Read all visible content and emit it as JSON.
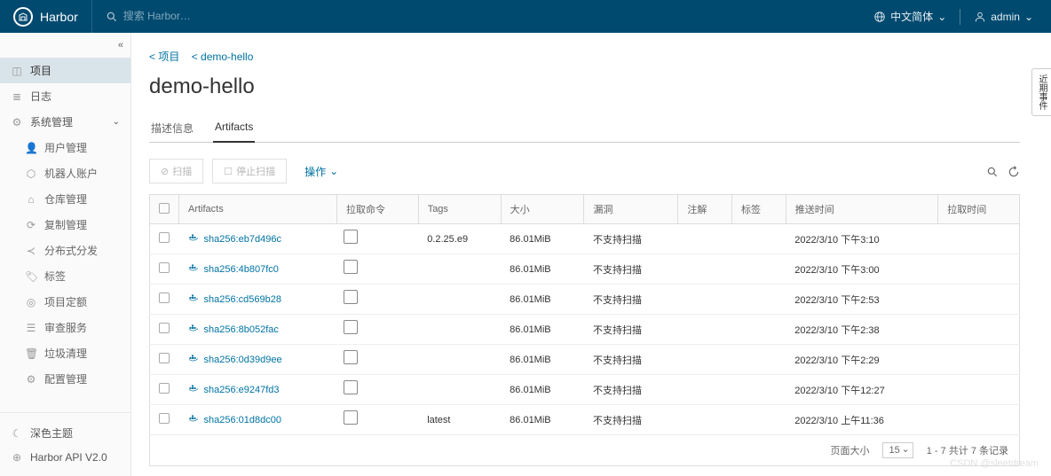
{
  "header": {
    "brand": "Harbor",
    "search_placeholder": "搜索 Harbor…",
    "language": "中文简体",
    "user": "admin"
  },
  "sidebar": {
    "projects": "项目",
    "logs": "日志",
    "admin": "系统管理",
    "sub": {
      "users": "用户管理",
      "robots": "机器人账户",
      "repos": "仓库管理",
      "replication": "复制管理",
      "distribution": "分布式分发",
      "labels": "标签",
      "quotas": "项目定额",
      "audit": "审查服务",
      "gc": "垃圾清理",
      "config": "配置管理"
    },
    "bottom": {
      "theme": "深色主题",
      "api": "Harbor API V2.0"
    }
  },
  "breadcrumb": {
    "back1": "< 项目",
    "back2": "< demo-hello"
  },
  "page_title": "demo-hello",
  "tabs": {
    "info": "描述信息",
    "artifacts": "Artifacts"
  },
  "toolbar": {
    "scan": "扫描",
    "stop_scan": "停止扫描",
    "actions": "操作"
  },
  "columns": {
    "artifacts": "Artifacts",
    "pull_cmd": "拉取命令",
    "tags": "Tags",
    "size": "大小",
    "vuln": "漏洞",
    "annotations": "注解",
    "labels": "标签",
    "push_time": "推送时间",
    "pull_time": "拉取时间"
  },
  "rows": [
    {
      "digest": "sha256:eb7d496c",
      "tags": "0.2.25.e9",
      "size": "86.01MiB",
      "vuln": "不支持扫描",
      "push": "2022/3/10 下午3:10"
    },
    {
      "digest": "sha256:4b807fc0",
      "tags": "",
      "size": "86.01MiB",
      "vuln": "不支持扫描",
      "push": "2022/3/10 下午3:00"
    },
    {
      "digest": "sha256:cd569b28",
      "tags": "",
      "size": "86.01MiB",
      "vuln": "不支持扫描",
      "push": "2022/3/10 下午2:53"
    },
    {
      "digest": "sha256:8b052fac",
      "tags": "",
      "size": "86.01MiB",
      "vuln": "不支持扫描",
      "push": "2022/3/10 下午2:38"
    },
    {
      "digest": "sha256:0d39d9ee",
      "tags": "",
      "size": "86.01MiB",
      "vuln": "不支持扫描",
      "push": "2022/3/10 下午2:29"
    },
    {
      "digest": "sha256:e9247fd3",
      "tags": "",
      "size": "86.01MiB",
      "vuln": "不支持扫描",
      "push": "2022/3/10 下午12:27"
    },
    {
      "digest": "sha256:01d8dc00",
      "tags": "latest",
      "size": "86.01MiB",
      "vuln": "不支持扫描",
      "push": "2022/3/10 上午11:36"
    }
  ],
  "footer": {
    "page_size_label": "页面大小",
    "page_size": "15",
    "range": "1 - 7 共计 7 条记录"
  },
  "right_tab": "近期事件",
  "watermark": "CSDN @sleetdream"
}
